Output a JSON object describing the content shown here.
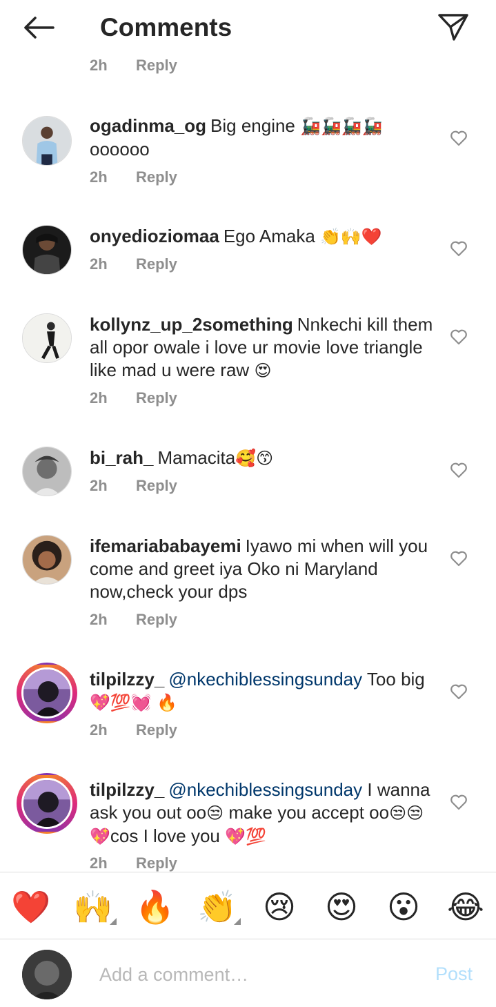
{
  "header": {
    "title": "Comments"
  },
  "partial_comment": {
    "time": "2h",
    "reply_label": "Reply"
  },
  "comments": [
    {
      "username": "ogadinma_og",
      "text": "Big engine",
      "emoji": "🚂🚂🚂🚂",
      "text2": "oooooo",
      "time": "2h",
      "reply_label": "Reply"
    },
    {
      "username": "onyedioziomaa",
      "text": "Ego Amaka",
      "emoji": "👏🙌❤️",
      "time": "2h",
      "reply_label": "Reply"
    },
    {
      "username": "kollynz_up_2something",
      "text": "Nnkechi kill them all opor owale i love ur movie love triangle like mad u were raw",
      "emoji": "😍",
      "time": "2h",
      "reply_label": "Reply"
    },
    {
      "username": "bi_rah_",
      "text": "Mamacita",
      "emoji": "🥰😙",
      "time": "2h",
      "reply_label": "Reply"
    },
    {
      "username": "ifemariababayemi",
      "text": "Iyawo mi when will you come and greet iya Oko ni Maryland now,check your dps",
      "time": "2h",
      "reply_label": "Reply"
    },
    {
      "username": "tilpilzzy_",
      "mention": "@nkechiblessingsunday",
      "text": "Too big",
      "emoji": "💖💯💓 🔥",
      "time": "2h",
      "reply_label": "Reply"
    },
    {
      "username": "tilpilzzy_",
      "mention": "@nkechiblessingsunday",
      "text": "I wanna ask you out oo",
      "emoji_a": "😒",
      "text_b": "make you accept oo",
      "emoji_b": "😒😒💖",
      "text_c": "cos I love you",
      "emoji_c": "💖💯",
      "time": "2h",
      "reply_label": "Reply"
    }
  ],
  "emoji_bar": [
    "❤️",
    "🙌",
    "🔥",
    "👏",
    "😢",
    "😍",
    "😮",
    "😂"
  ],
  "input": {
    "placeholder": "Add a comment…",
    "post_label": "Post"
  },
  "colors": {
    "mention": "#00376b",
    "meta": "#8e8e8e",
    "post_disabled": "#b2dffc"
  }
}
